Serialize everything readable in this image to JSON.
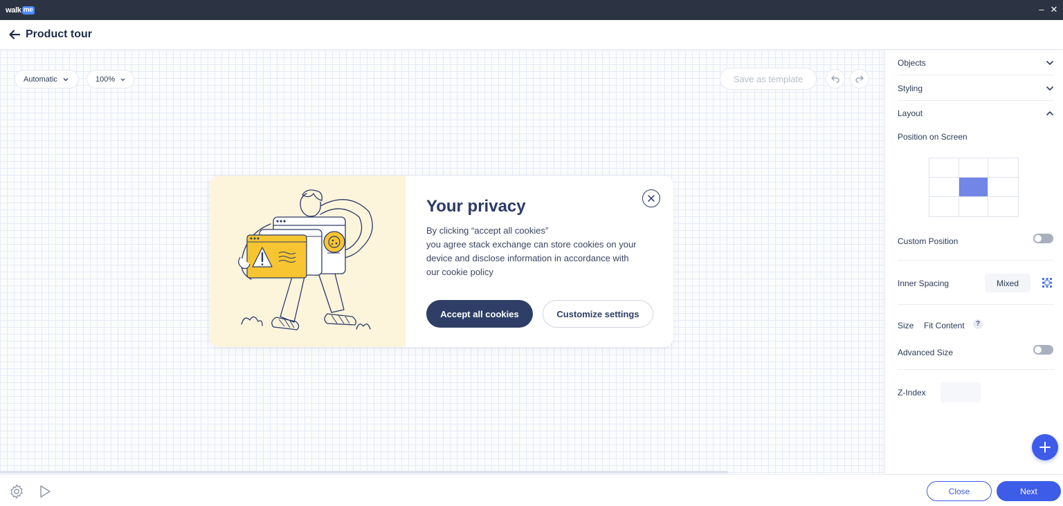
{
  "window": {
    "brand_walk": "walk",
    "brand_me": "me",
    "minimize_glyph": "–",
    "close_glyph": "✕"
  },
  "header": {
    "title": "Product tour",
    "back_icon": "arrow-left-icon"
  },
  "toolbar": {
    "layout_mode": "Automatic",
    "zoom": "100%",
    "save_template_label": "Save as template",
    "undo_icon": "undo-icon",
    "redo_icon": "redo-icon"
  },
  "dialog": {
    "title": "Your privacy",
    "body_lines": [
      "By clicking “accept all cookies”",
      "you agree stack exchange can store cookies on your",
      "device and disclose information in accordance with",
      "our cookie policy"
    ],
    "accept_label": "Accept all cookies",
    "customize_label": "Customize settings",
    "close_icon": "close-circle-icon",
    "illustration": "person-carrying-cookie-warning-windows-illustration"
  },
  "panel": {
    "sections": {
      "objects": "Objects",
      "styling": "Styling",
      "layout": "Layout"
    },
    "position_label": "Position on Screen",
    "position_value": "Center Middle",
    "position_grid_selected": "middle-center",
    "custom_position_label": "Custom Position",
    "custom_position_on": false,
    "inner_spacing_label": "Inner Spacing",
    "inner_spacing_value": "Mixed",
    "size_label": "Size",
    "size_value": "Fit Content",
    "help_glyph": "?",
    "advanced_size_label": "Advanced Size",
    "advanced_size_on": false,
    "zindex_label": "Z-Index",
    "zindex_value": ""
  },
  "footer": {
    "close_label": "Close",
    "next_label": "Next",
    "settings_icon": "gear-icon",
    "play_icon": "play-icon"
  },
  "colors": {
    "titlebar": "#2c3443",
    "primary": "#3d5ce8",
    "dialog_dark": "#2e3e66",
    "illustration_bg": "#fdf4dc",
    "accent_yellow": "#f7c531",
    "grid_selected": "#7286e6"
  }
}
